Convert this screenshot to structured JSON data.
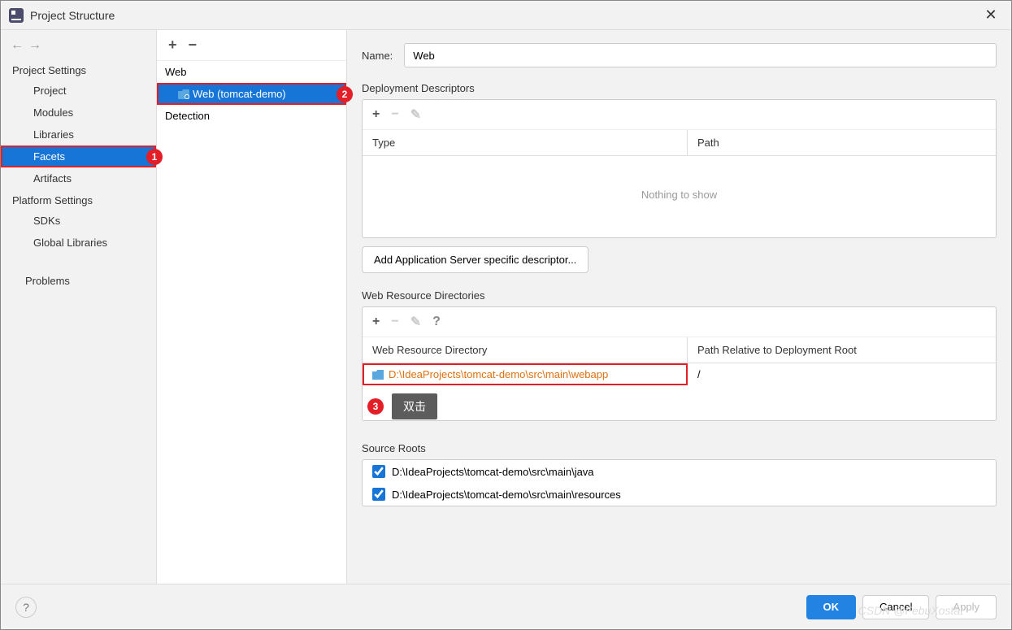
{
  "dialog": {
    "title": "Project Structure"
  },
  "nav": {
    "projectSettingsHeader": "Project Settings",
    "items1": [
      "Project",
      "Modules",
      "Libraries",
      "Facets",
      "Artifacts"
    ],
    "platformSettingsHeader": "Platform Settings",
    "items2": [
      "SDKs",
      "Global Libraries"
    ],
    "problems": "Problems"
  },
  "middle": {
    "rootItem": "Web",
    "childItem": "Web (tomcat-demo)",
    "detectionItem": "Detection"
  },
  "right": {
    "nameLabel": "Name:",
    "nameValue": "Web",
    "deploymentDescriptors": {
      "title": "Deployment Descriptors",
      "typeHeader": "Type",
      "pathHeader": "Path",
      "empty": "Nothing to show"
    },
    "addDescriptorButton": "Add Application Server specific descriptor...",
    "webResourceDirectories": {
      "title": "Web Resource Directories",
      "dirHeader": "Web Resource Directory",
      "pathHeader": "Path Relative to Deployment Root",
      "row": {
        "dir": "D:\\IdeaProjects\\tomcat-demo\\src\\main\\webapp",
        "relPath": "/"
      }
    },
    "sourceRoots": {
      "title": "Source Roots",
      "items": [
        "D:\\IdeaProjects\\tomcat-demo\\src\\main\\java",
        "D:\\IdeaProjects\\tomcat-demo\\src\\main\\resources"
      ]
    }
  },
  "footer": {
    "ok": "OK",
    "cancel": "Cancel",
    "apply": "Apply"
  },
  "annotations": {
    "badge1": "1",
    "badge2": "2",
    "badge3": "3",
    "tooltip3": "双击"
  },
  "watermark": "CSDN @FebuXostat"
}
